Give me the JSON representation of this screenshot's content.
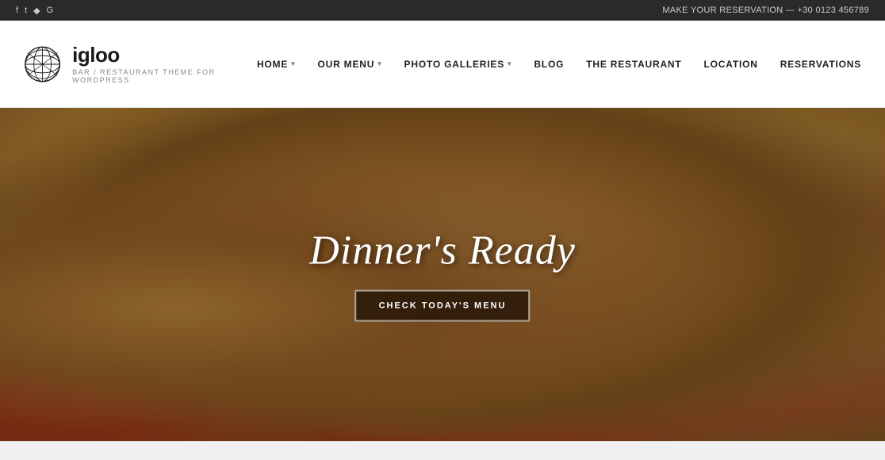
{
  "topbar": {
    "social_icons": [
      "f",
      "t",
      "i",
      "g"
    ],
    "phone_text": "MAKE YOUR RESERVATION — +30 0123 456789"
  },
  "header": {
    "logo_name": "igloo",
    "logo_tagline": "BAR / RESTAURANT THEME FOR WORDPRESS",
    "nav_items": [
      {
        "label": "HOME",
        "has_arrow": true
      },
      {
        "label": "OUR MENU",
        "has_arrow": true
      },
      {
        "label": "PHOTO GALLERIES",
        "has_arrow": true
      },
      {
        "label": "BLOG",
        "has_arrow": false
      },
      {
        "label": "THE RESTAURANT",
        "has_arrow": false
      },
      {
        "label": "LOCATION",
        "has_arrow": false
      },
      {
        "label": "RESERVATIONS",
        "has_arrow": false
      }
    ]
  },
  "hero": {
    "title": "Dinner's Ready",
    "cta_label": "CHECK TODAY'S MENU"
  }
}
